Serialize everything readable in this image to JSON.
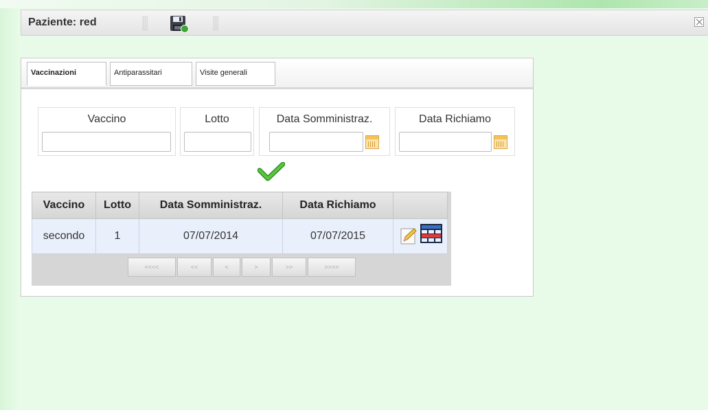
{
  "window": {
    "title": "Paziente: red"
  },
  "tabs": [
    {
      "label": "Vaccinazioni",
      "active": true
    },
    {
      "label": "Antiparassitari",
      "active": false
    },
    {
      "label": "Visite generali",
      "active": false
    }
  ],
  "form": {
    "vaccino_label": "Vaccino",
    "vaccino_value": "",
    "lotto_label": "Lotto",
    "lotto_value": "",
    "data_somm_label": "Data Somministraz.",
    "data_somm_value": "",
    "data_rich_label": "Data Richiamo",
    "data_rich_value": ""
  },
  "table": {
    "columns": [
      "Vaccino",
      "Lotto",
      "Data Somministraz.",
      "Data Richiamo",
      ""
    ],
    "rows": [
      {
        "vaccino": "secondo",
        "lotto": "1",
        "data_somm": "07/07/2014",
        "data_rich": "07/07/2015"
      }
    ]
  },
  "pager": {
    "first": "<<<<",
    "prev_page": "<<",
    "prev": "<",
    "next": ">",
    "next_page": ">>",
    "last": ">>>>"
  },
  "icons": {
    "save": "floppy-disk-icon",
    "close": "close-icon",
    "calendar": "calendar-icon",
    "confirm": "check-icon",
    "edit": "pencil-icon",
    "delete": "table-remove-icon"
  },
  "colors": {
    "background": "#e8fbe8",
    "confirm_green": "#3fae2a",
    "row_bg": "#eaf0fb"
  }
}
